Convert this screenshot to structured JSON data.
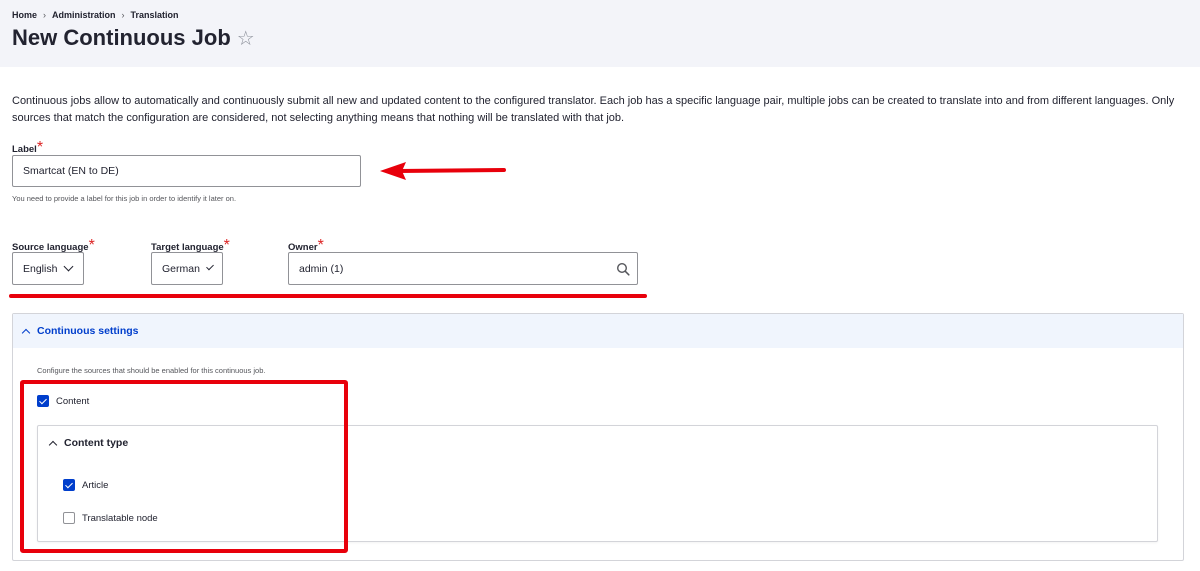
{
  "breadcrumb": {
    "items": [
      "Home",
      "Administration",
      "Translation"
    ],
    "separator": "›"
  },
  "page": {
    "title": "New Continuous Job",
    "favorite_icon": "star-icon"
  },
  "description": "Continuous jobs allow to automatically and continuously submit all new and updated content to the configured translator. Each job has a specific language pair, multiple jobs can be created to translate into and from different languages. Only sources that match the configuration are considered, not selecting anything means that nothing will be translated with that job.",
  "label_field": {
    "label": "Label",
    "required_mark": "*",
    "value": "Smartcat (EN to DE)",
    "help": "You need to provide a label for this job in order to identify it later on."
  },
  "source_language": {
    "label": "Source language",
    "required_mark": "*",
    "value": "English"
  },
  "target_language": {
    "label": "Target language",
    "required_mark": "*",
    "value": "German"
  },
  "owner": {
    "label": "Owner",
    "required_mark": "*",
    "value": "admin (1)",
    "icon": "search-icon"
  },
  "continuous_settings": {
    "summary": "Continuous settings",
    "description": "Configure the sources that should be enabled for this continuous job.",
    "content_checkbox": {
      "label": "Content",
      "checked": true
    },
    "content_type": {
      "summary": "Content type",
      "options": [
        {
          "label": "Article",
          "checked": true
        },
        {
          "label": "Translatable node",
          "checked": false
        }
      ]
    }
  },
  "annotation_colors": {
    "highlight": "#e8000b",
    "accent": "#003ecc"
  }
}
